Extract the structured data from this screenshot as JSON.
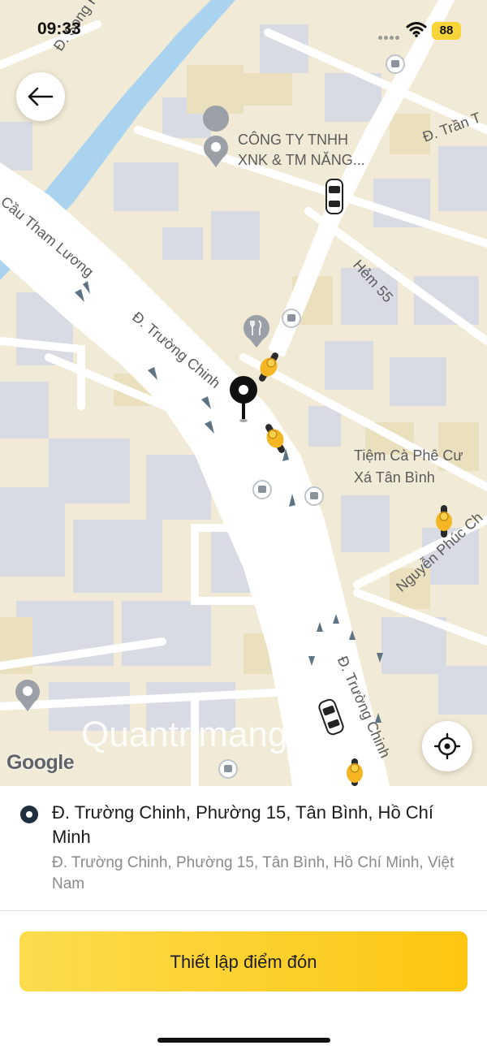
{
  "status": {
    "time": "09:33",
    "battery": "88"
  },
  "map": {
    "labels": {
      "song_hanh": "Đ. Song Hành",
      "company_line1": "CÔNG TY TNHH",
      "company_line2": "XNK & TM NĂNG...",
      "tran": "Đ. Trần T",
      "cau_tham_luong": "Cầu Tham Lương",
      "truong_chinh_upper": "Đ. Trường Chinh",
      "hem_55": "Hẻm 55",
      "cafe_line1": "Tiệm Cà Phê Cư",
      "cafe_line2": "Xá Tân Bình",
      "nguyen_phuc": "Nguyễn Phúc Ch",
      "truong_chinh_lower": "Đ. Trường Chinh"
    },
    "attribution": "Google",
    "watermark": "Quantrimang"
  },
  "pickup": {
    "title": "Đ. Trường Chinh, Phường 15, Tân Bình, Hồ Chí Minh",
    "subtitle": "Đ. Trường Chinh, Phường 15, Tân Bình, Hồ Chí Minh, Việt Nam"
  },
  "actions": {
    "confirm_label": "Thiết lập điểm đón"
  },
  "icons": [
    "back-arrow-icon",
    "my-location-icon",
    "pin-icon",
    "bus-stop-icon",
    "restaurant-icon",
    "motorbike-icon",
    "car-icon",
    "wifi-icon"
  ],
  "colors": {
    "accent": "#fdc611",
    "pin": "#111111",
    "map_bg": "#f1ead6",
    "road": "#ffffff",
    "water": "#a9d3ef"
  }
}
